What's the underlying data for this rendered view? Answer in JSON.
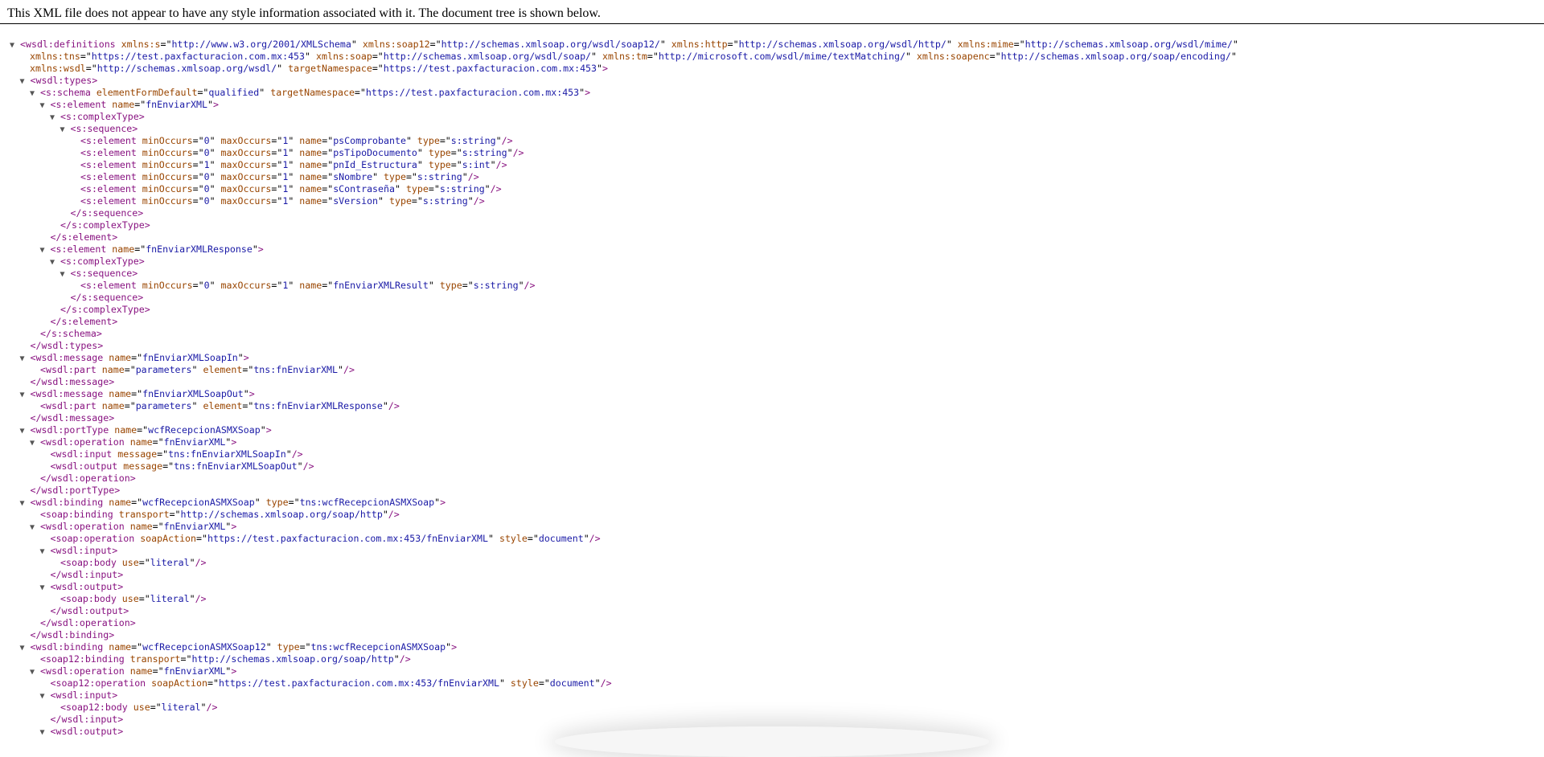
{
  "header": {
    "message": "This XML file does not appear to have any style information associated with it. The document tree is shown below."
  },
  "tree": [
    {
      "i": 0,
      "t": "open",
      "tw": 1,
      "n": "wsdl:definitions",
      "a": [
        [
          "xmlns:s",
          "http://www.w3.org/2001/XMLSchema"
        ],
        [
          "xmlns:soap12",
          "http://schemas.xmlsoap.org/wsdl/soap12/"
        ],
        [
          "xmlns:http",
          "http://schemas.xmlsoap.org/wsdl/http/"
        ],
        [
          "xmlns:mime",
          "http://schemas.xmlsoap.org/wsdl/mime/"
        ]
      ],
      "cont": true
    },
    {
      "i": 0.4,
      "t": "attrs",
      "a": [
        [
          "xmlns:tns",
          "https://test.paxfacturacion.com.mx:453"
        ],
        [
          "xmlns:soap",
          "http://schemas.xmlsoap.org/wsdl/soap/"
        ],
        [
          "xmlns:tm",
          "http://microsoft.com/wsdl/mime/textMatching/"
        ],
        [
          "xmlns:soapenc",
          "http://schemas.xmlsoap.org/soap/encoding/"
        ]
      ],
      "cont": true
    },
    {
      "i": 0.4,
      "t": "attrs",
      "a": [
        [
          "xmlns:wsdl",
          "http://schemas.xmlsoap.org/wsdl/"
        ],
        [
          "targetNamespace",
          "https://test.paxfacturacion.com.mx:453"
        ]
      ],
      "end": ">"
    },
    {
      "i": 1,
      "t": "open",
      "tw": 1,
      "n": "wsdl:types",
      "a": []
    },
    {
      "i": 2,
      "t": "open",
      "tw": 1,
      "n": "s:schema",
      "a": [
        [
          "elementFormDefault",
          "qualified"
        ],
        [
          "targetNamespace",
          "https://test.paxfacturacion.com.mx:453"
        ]
      ]
    },
    {
      "i": 3,
      "t": "open",
      "tw": 1,
      "n": "s:element",
      "a": [
        [
          "name",
          "fnEnviarXML"
        ]
      ]
    },
    {
      "i": 4,
      "t": "open",
      "tw": 1,
      "n": "s:complexType",
      "a": []
    },
    {
      "i": 5,
      "t": "open",
      "tw": 1,
      "n": "s:sequence",
      "a": []
    },
    {
      "i": 6,
      "t": "empty",
      "n": "s:element",
      "a": [
        [
          "minOccurs",
          "0"
        ],
        [
          "maxOccurs",
          "1"
        ],
        [
          "name",
          "psComprobante"
        ],
        [
          "type",
          "s:string"
        ]
      ]
    },
    {
      "i": 6,
      "t": "empty",
      "n": "s:element",
      "a": [
        [
          "minOccurs",
          "0"
        ],
        [
          "maxOccurs",
          "1"
        ],
        [
          "name",
          "psTipoDocumento"
        ],
        [
          "type",
          "s:string"
        ]
      ]
    },
    {
      "i": 6,
      "t": "empty",
      "n": "s:element",
      "a": [
        [
          "minOccurs",
          "1"
        ],
        [
          "maxOccurs",
          "1"
        ],
        [
          "name",
          "pnId_Estructura"
        ],
        [
          "type",
          "s:int"
        ]
      ]
    },
    {
      "i": 6,
      "t": "empty",
      "n": "s:element",
      "a": [
        [
          "minOccurs",
          "0"
        ],
        [
          "maxOccurs",
          "1"
        ],
        [
          "name",
          "sNombre"
        ],
        [
          "type",
          "s:string"
        ]
      ]
    },
    {
      "i": 6,
      "t": "empty",
      "n": "s:element",
      "a": [
        [
          "minOccurs",
          "0"
        ],
        [
          "maxOccurs",
          "1"
        ],
        [
          "name",
          "sContraseña"
        ],
        [
          "type",
          "s:string"
        ]
      ]
    },
    {
      "i": 6,
      "t": "empty",
      "n": "s:element",
      "a": [
        [
          "minOccurs",
          "0"
        ],
        [
          "maxOccurs",
          "1"
        ],
        [
          "name",
          "sVersion"
        ],
        [
          "type",
          "s:string"
        ]
      ]
    },
    {
      "i": 5,
      "t": "close",
      "n": "s:sequence"
    },
    {
      "i": 4,
      "t": "close",
      "n": "s:complexType"
    },
    {
      "i": 3,
      "t": "close",
      "n": "s:element"
    },
    {
      "i": 3,
      "t": "open",
      "tw": 1,
      "n": "s:element",
      "a": [
        [
          "name",
          "fnEnviarXMLResponse"
        ]
      ]
    },
    {
      "i": 4,
      "t": "open",
      "tw": 1,
      "n": "s:complexType",
      "a": []
    },
    {
      "i": 5,
      "t": "open",
      "tw": 1,
      "n": "s:sequence",
      "a": []
    },
    {
      "i": 6,
      "t": "empty",
      "n": "s:element",
      "a": [
        [
          "minOccurs",
          "0"
        ],
        [
          "maxOccurs",
          "1"
        ],
        [
          "name",
          "fnEnviarXMLResult"
        ],
        [
          "type",
          "s:string"
        ]
      ]
    },
    {
      "i": 5,
      "t": "close",
      "n": "s:sequence"
    },
    {
      "i": 4,
      "t": "close",
      "n": "s:complexType"
    },
    {
      "i": 3,
      "t": "close",
      "n": "s:element"
    },
    {
      "i": 2,
      "t": "close",
      "n": "s:schema"
    },
    {
      "i": 1,
      "t": "close",
      "n": "wsdl:types"
    },
    {
      "i": 1,
      "t": "open",
      "tw": 1,
      "n": "wsdl:message",
      "a": [
        [
          "name",
          "fnEnviarXMLSoapIn"
        ]
      ]
    },
    {
      "i": 2,
      "t": "empty",
      "n": "wsdl:part",
      "a": [
        [
          "name",
          "parameters"
        ],
        [
          "element",
          "tns:fnEnviarXML"
        ]
      ]
    },
    {
      "i": 1,
      "t": "close",
      "n": "wsdl:message"
    },
    {
      "i": 1,
      "t": "open",
      "tw": 1,
      "n": "wsdl:message",
      "a": [
        [
          "name",
          "fnEnviarXMLSoapOut"
        ]
      ]
    },
    {
      "i": 2,
      "t": "empty",
      "n": "wsdl:part",
      "a": [
        [
          "name",
          "parameters"
        ],
        [
          "element",
          "tns:fnEnviarXMLResponse"
        ]
      ]
    },
    {
      "i": 1,
      "t": "close",
      "n": "wsdl:message"
    },
    {
      "i": 1,
      "t": "open",
      "tw": 1,
      "n": "wsdl:portType",
      "a": [
        [
          "name",
          "wcfRecepcionASMXSoap"
        ]
      ]
    },
    {
      "i": 2,
      "t": "open",
      "tw": 1,
      "n": "wsdl:operation",
      "a": [
        [
          "name",
          "fnEnviarXML"
        ]
      ]
    },
    {
      "i": 3,
      "t": "empty",
      "n": "wsdl:input",
      "a": [
        [
          "message",
          "tns:fnEnviarXMLSoapIn"
        ]
      ]
    },
    {
      "i": 3,
      "t": "empty",
      "n": "wsdl:output",
      "a": [
        [
          "message",
          "tns:fnEnviarXMLSoapOut"
        ]
      ]
    },
    {
      "i": 2,
      "t": "close",
      "n": "wsdl:operation"
    },
    {
      "i": 1,
      "t": "close",
      "n": "wsdl:portType"
    },
    {
      "i": 1,
      "t": "open",
      "tw": 1,
      "n": "wsdl:binding",
      "a": [
        [
          "name",
          "wcfRecepcionASMXSoap"
        ],
        [
          "type",
          "tns:wcfRecepcionASMXSoap"
        ]
      ]
    },
    {
      "i": 2,
      "t": "empty",
      "n": "soap:binding",
      "a": [
        [
          "transport",
          "http://schemas.xmlsoap.org/soap/http"
        ]
      ]
    },
    {
      "i": 2,
      "t": "open",
      "tw": 1,
      "n": "wsdl:operation",
      "a": [
        [
          "name",
          "fnEnviarXML"
        ]
      ]
    },
    {
      "i": 3,
      "t": "empty",
      "n": "soap:operation",
      "a": [
        [
          "soapAction",
          "https://test.paxfacturacion.com.mx:453/fnEnviarXML"
        ],
        [
          "style",
          "document"
        ]
      ]
    },
    {
      "i": 3,
      "t": "open",
      "tw": 1,
      "n": "wsdl:input",
      "a": []
    },
    {
      "i": 4,
      "t": "empty",
      "n": "soap:body",
      "a": [
        [
          "use",
          "literal"
        ]
      ]
    },
    {
      "i": 3,
      "t": "close",
      "n": "wsdl:input"
    },
    {
      "i": 3,
      "t": "open",
      "tw": 1,
      "n": "wsdl:output",
      "a": []
    },
    {
      "i": 4,
      "t": "empty",
      "n": "soap:body",
      "a": [
        [
          "use",
          "literal"
        ]
      ]
    },
    {
      "i": 3,
      "t": "close",
      "n": "wsdl:output"
    },
    {
      "i": 2,
      "t": "close",
      "n": "wsdl:operation"
    },
    {
      "i": 1,
      "t": "close",
      "n": "wsdl:binding"
    },
    {
      "i": 1,
      "t": "open",
      "tw": 1,
      "n": "wsdl:binding",
      "a": [
        [
          "name",
          "wcfRecepcionASMXSoap12"
        ],
        [
          "type",
          "tns:wcfRecepcionASMXSoap"
        ]
      ]
    },
    {
      "i": 2,
      "t": "empty",
      "n": "soap12:binding",
      "a": [
        [
          "transport",
          "http://schemas.xmlsoap.org/soap/http"
        ]
      ]
    },
    {
      "i": 2,
      "t": "open",
      "tw": 1,
      "n": "wsdl:operation",
      "a": [
        [
          "name",
          "fnEnviarXML"
        ]
      ]
    },
    {
      "i": 3,
      "t": "empty",
      "n": "soap12:operation",
      "a": [
        [
          "soapAction",
          "https://test.paxfacturacion.com.mx:453/fnEnviarXML"
        ],
        [
          "style",
          "document"
        ]
      ]
    },
    {
      "i": 3,
      "t": "open",
      "tw": 1,
      "n": "wsdl:input",
      "a": []
    },
    {
      "i": 4,
      "t": "empty",
      "n": "soap12:body",
      "a": [
        [
          "use",
          "literal"
        ]
      ]
    },
    {
      "i": 3,
      "t": "close",
      "n": "wsdl:input"
    },
    {
      "i": 3,
      "t": "open",
      "tw": 1,
      "n": "wsdl:output",
      "a": []
    }
  ],
  "colors": {
    "tag": "#881280",
    "attr_name": "#994500",
    "attr_value": "#1a1aa6",
    "toggle": "#555555"
  },
  "icons": {
    "expanded_toggle": "triangle-down-icon"
  }
}
